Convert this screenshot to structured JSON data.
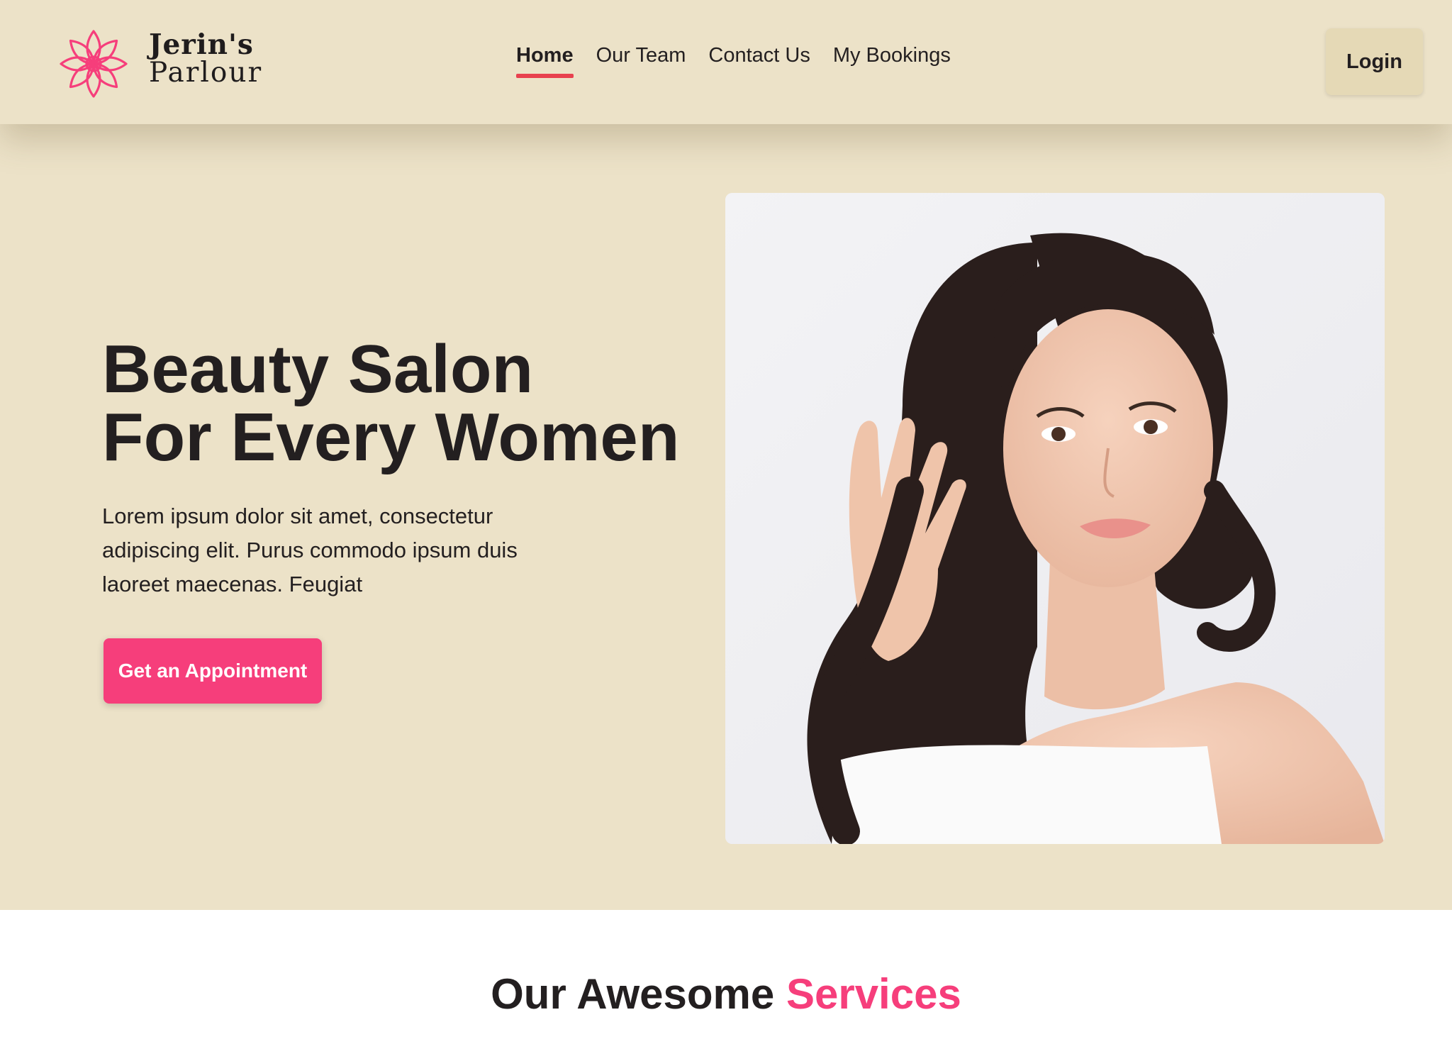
{
  "brand": {
    "name_line1": "Jerin's",
    "name_line2": "Parlour",
    "logo_icon": "lotus-flower-icon",
    "accent_color": "#f63e7b"
  },
  "nav": {
    "items": [
      {
        "label": "Home",
        "active": true
      },
      {
        "label": "Our Team",
        "active": false
      },
      {
        "label": "Contact Us",
        "active": false
      },
      {
        "label": "My Bookings",
        "active": false
      }
    ],
    "login_label": "Login"
  },
  "hero": {
    "title_line1": "Beauty Salon",
    "title_line2": "For Every Women",
    "description": "Lorem ipsum dolor sit amet, consectetur adipiscing elit. Purus commodo ipsum duis laoreet maecenas. Feugiat",
    "cta_label": "Get an Appointment"
  },
  "services": {
    "title_prefix": "Our Awesome",
    "title_accent": "Services"
  },
  "colors": {
    "header_bg": "#ece2c8",
    "hero_bg": "#ece2c8",
    "cta_bg": "#f63e7b",
    "active_underline": "#e8414f",
    "login_bg": "#e5d9b6",
    "text": "#231f20"
  }
}
